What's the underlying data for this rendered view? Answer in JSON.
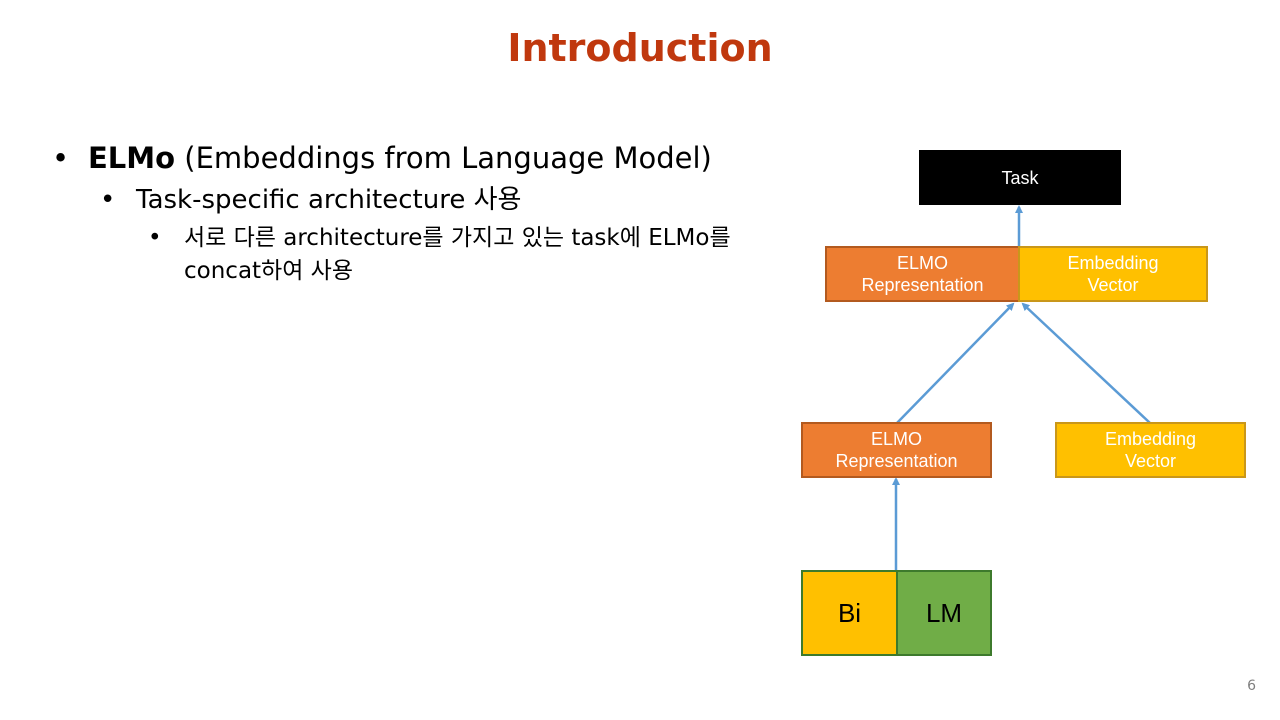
{
  "slide": {
    "title": "Introduction",
    "page_number": "6"
  },
  "bullets": {
    "level1_bold": "ELMo",
    "level1_rest": " (Embeddings from Language Model)",
    "level2": "Task-specific architecture 사용",
    "level3": "서로 다른 architecture를 가지고 있는 task에 ELMo를 concat하여 사용"
  },
  "diagram": {
    "task_label": "Task",
    "top_elmo_line1": "ELMO",
    "top_elmo_line2": "Representation",
    "top_emb_line1": "Embedding",
    "top_emb_line2": "Vector",
    "mid_elmo_line1": "ELMO",
    "mid_elmo_line2": "Representation",
    "mid_emb_line1": "Embedding",
    "mid_emb_line2": "Vector",
    "bi_label": "Bi",
    "lm_label": "LM",
    "colors": {
      "title": "#c0380e",
      "elmo": "#ed7d31",
      "embedding": "#ffc000",
      "lm": "#70ad47",
      "task": "#000000",
      "arrow": "#5b9bd5"
    }
  }
}
